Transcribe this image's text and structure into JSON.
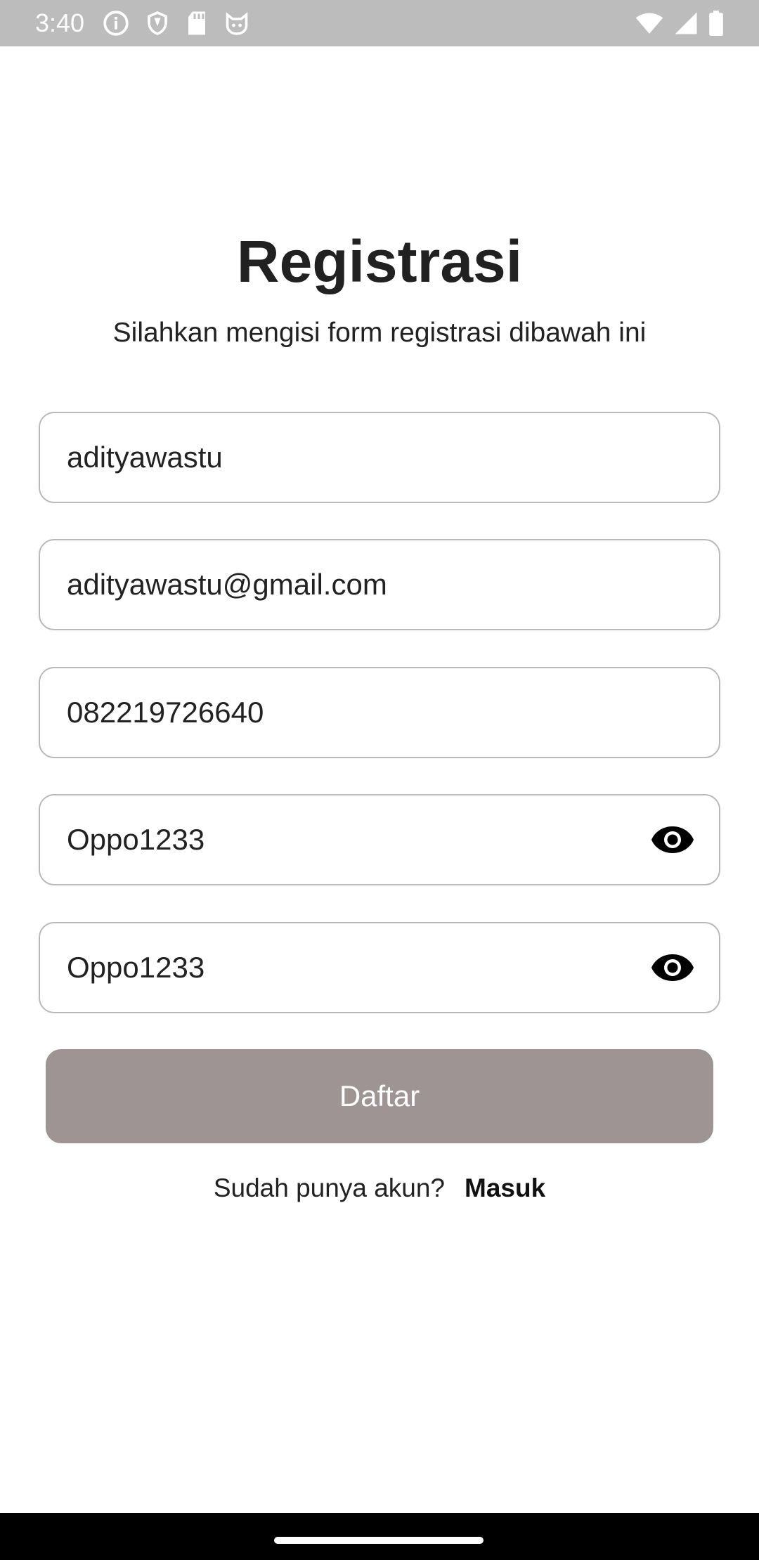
{
  "status_bar": {
    "time": "3:40",
    "left_icons": [
      "info-icon",
      "shield-icon",
      "sd-card-icon",
      "cat-face-icon"
    ],
    "right_icons": [
      "wifi-icon",
      "signal-icon",
      "battery-icon"
    ]
  },
  "header": {
    "title": "Registrasi",
    "subtitle": "Silahkan mengisi form registrasi dibawah ini"
  },
  "form": {
    "username": {
      "value": "adityawastu"
    },
    "email": {
      "value": "adityawastu@gmail.com"
    },
    "phone": {
      "value": "082219726640"
    },
    "password": {
      "value": "Oppo1233",
      "icon": "eye-icon"
    },
    "confirm_password": {
      "value": "Oppo1233",
      "icon": "eye-icon"
    },
    "submit_label": "Daftar"
  },
  "footer": {
    "question": "Sudah punya akun?",
    "login_link": "Masuk"
  },
  "colors": {
    "status_bar_bg": "#bcbcbc",
    "button_bg": "#9e9494",
    "field_border": "#b9b9b9",
    "nav_bar_bg": "#000000"
  }
}
